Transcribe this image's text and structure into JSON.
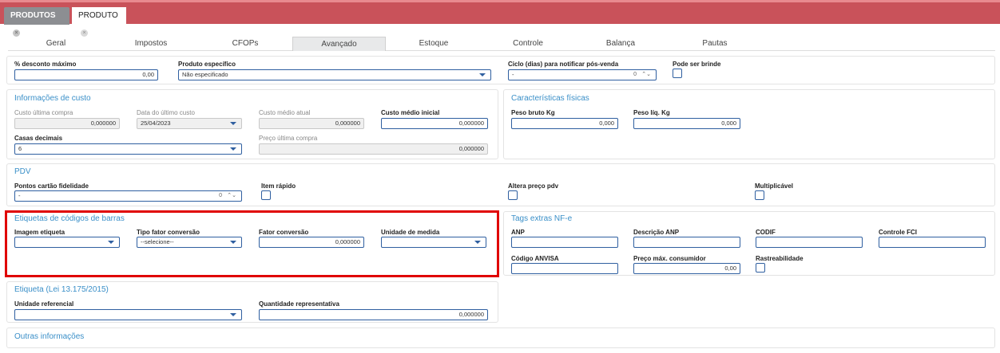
{
  "tabs": {
    "produtos": "PRODUTOS",
    "produto": "PRODUTO",
    "close": "×"
  },
  "nav": [
    "Geral",
    "Impostos",
    "CFOPs",
    "Avançado",
    "Estoque",
    "Controle",
    "Balança",
    "Pautas"
  ],
  "row1": {
    "desconto_label": "% desconto máximo",
    "desconto_value": "0,00",
    "produto_esp_label": "Produto específico",
    "produto_esp_value": "Não especificado",
    "ciclo_label": "Ciclo (dias) para notificar pós-venda",
    "ciclo_value": "-",
    "ciclo_num": "0",
    "brinde_label": "Pode ser brinde"
  },
  "custo": {
    "title": "Informações de custo",
    "ultima_compra_label": "Custo última compra",
    "ultima_compra_value": "0,000000",
    "data_ultimo_label": "Data do último custo",
    "data_ultimo_value": "25/04/2023",
    "medio_atual_label": "Custo médio atual",
    "medio_atual_value": "0,000000",
    "medio_inicial_label": "Custo médio inicial",
    "medio_inicial_value": "0,000000",
    "casas_label": "Casas decimais",
    "casas_value": "6",
    "preco_ultima_label": "Preço última compra",
    "preco_ultima_value": "0,000000"
  },
  "fisicas": {
    "title": "Características físicas",
    "bruto_label": "Peso bruto Kg",
    "bruto_value": "0,000",
    "liq_label": "Peso líq. Kg",
    "liq_value": "0,000"
  },
  "pdv": {
    "title": "PDV",
    "pontos_label": "Pontos cartão fidelidade",
    "pontos_value": "-",
    "pontos_num": "0",
    "rapido_label": "Item rápido",
    "altera_label": "Altera preço pdv",
    "mult_label": "Multiplicável"
  },
  "etiquetas": {
    "title": "Etiquetas de códigos de barras",
    "imagem_label": "Imagem etiqueta",
    "imagem_value": "",
    "tipo_label": "Tipo fator conversão",
    "tipo_value": "--selecione--",
    "fator_label": "Fator conversão",
    "fator_value": "0,000000",
    "unidade_label": "Unidade de medida",
    "unidade_value": ""
  },
  "tags": {
    "title": "Tags extras NF-e",
    "anp_label": "ANP",
    "desc_anp_label": "Descrição ANP",
    "codif_label": "CODIF",
    "fci_label": "Controle FCI",
    "anvisa_label": "Código ANVISA",
    "preco_max_label": "Preço máx. consumidor",
    "preco_max_value": "0,00",
    "rastre_label": "Rastreabilidade"
  },
  "lei": {
    "title": "Etiqueta (Lei 13.175/2015)",
    "unidade_ref_label": "Unidade referencial",
    "unidade_ref_value": "",
    "qtd_label": "Quantidade representativa",
    "qtd_value": "0,000000"
  },
  "outras": {
    "title": "Outras informações"
  }
}
